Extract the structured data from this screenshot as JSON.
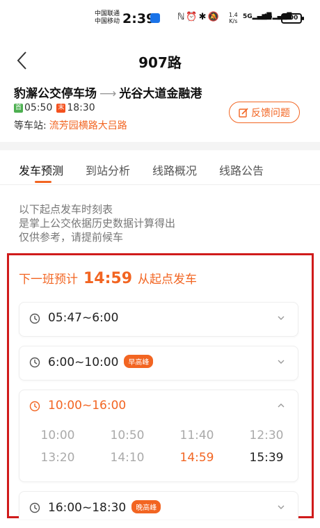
{
  "status_bar": {
    "carrier1": "中国联通",
    "carrier2": "中国移动",
    "time": "2:39",
    "net_speed": "1.4",
    "net_unit": "K/s",
    "sig1": "5G",
    "sig2": "4G",
    "battery": "100"
  },
  "header": {
    "title": "907路"
  },
  "route": {
    "from": "豹澥公交停车场",
    "to": "光谷大道金融港",
    "first_tag": "首",
    "first_time": "05:50",
    "last_tag": "末",
    "last_time": "18:30",
    "waiting_label": "等车站:",
    "waiting_station": "流芳园横路大吕路",
    "feedback_label": "反馈问题"
  },
  "tabs": [
    "发车预测",
    "到站分析",
    "线路概况",
    "线路公告"
  ],
  "note": {
    "line1": "以下起点发车时刻表",
    "line2": "是掌上公交依据历史数据计算得出",
    "line3": "仅供参考，请提前候车"
  },
  "next_bus": {
    "prefix": "下一班预计",
    "time": "14:59",
    "suffix": "从起点发车"
  },
  "periods": [
    {
      "range": "05:47~6:00",
      "peak": ""
    },
    {
      "range": "6:00~10:00",
      "peak": "早高峰"
    },
    {
      "range": "10:00~16:00",
      "peak": "",
      "departures": [
        "10:00",
        "10:50",
        "11:40",
        "12:30",
        "13:20",
        "14:10",
        "14:59",
        "15:39"
      ]
    },
    {
      "range": "16:00~18:30",
      "peak": "晚高峰"
    }
  ],
  "colors": {
    "accent": "#f26522",
    "highlight_border": "#d01b1b"
  }
}
